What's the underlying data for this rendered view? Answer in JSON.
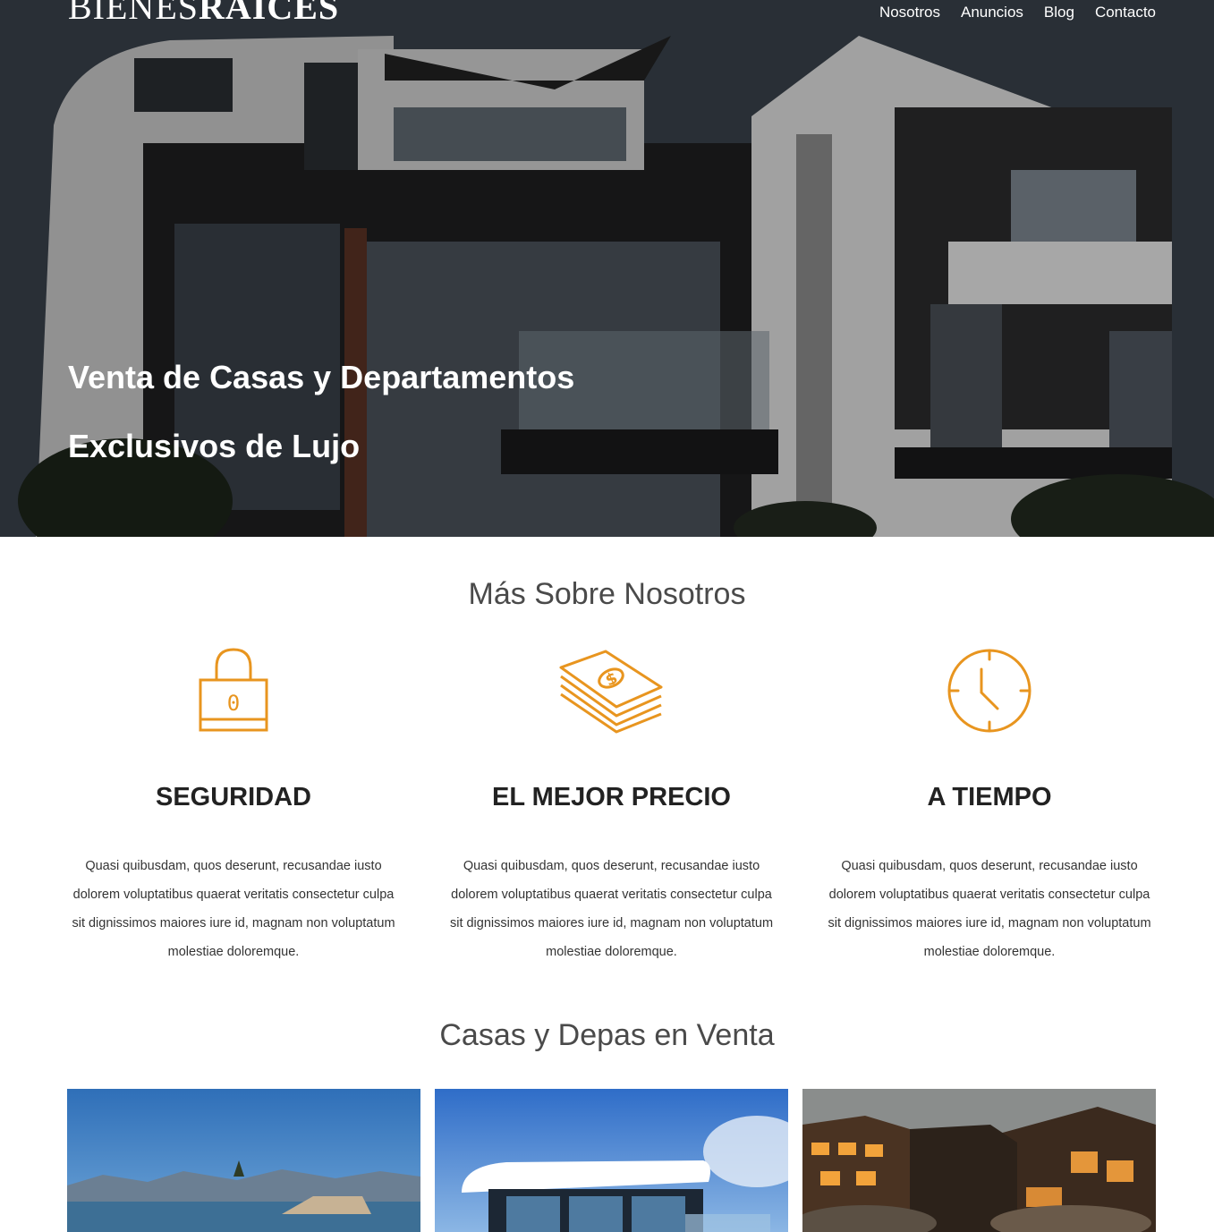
{
  "header": {
    "logo": {
      "light": "BIENES",
      "bold": "RAICES"
    },
    "nav": [
      "Nosotros",
      "Anuncios",
      "Blog",
      "Contacto"
    ],
    "hero_title": "Venta de Casas y Departamentos Exclusivos de Lujo"
  },
  "about": {
    "title": "Más Sobre Nosotros",
    "features": [
      {
        "icon": "padlock-icon",
        "title": "SEGURIDAD",
        "text": "Quasi quibusdam, quos deserunt, recusandae iusto dolorem voluptatibus quaerat veritatis consectetur culpa sit dignissimos maiores iure id, magnam non voluptatum molestiae doloremque."
      },
      {
        "icon": "money-stack-icon",
        "title": "EL MEJOR PRECIO",
        "text": "Quasi quibusdam, quos deserunt, recusandae iusto dolorem voluptatibus quaerat veritatis consectetur culpa sit dignissimos maiores iure id, magnam non voluptatum molestiae doloremque."
      },
      {
        "icon": "clock-icon",
        "title": "A TIEMPO",
        "text": "Quasi quibusdam, quos deserunt, recusandae iusto dolorem voluptatibus quaerat veritatis consectetur culpa sit dignissimos maiores iure id, magnam non voluptatum molestiae doloremque."
      }
    ]
  },
  "listings": {
    "title": "Casas y Depas en Venta"
  },
  "colors": {
    "accent": "#e8951f",
    "heading": "#222222",
    "section_title": "#4a4a4a"
  }
}
